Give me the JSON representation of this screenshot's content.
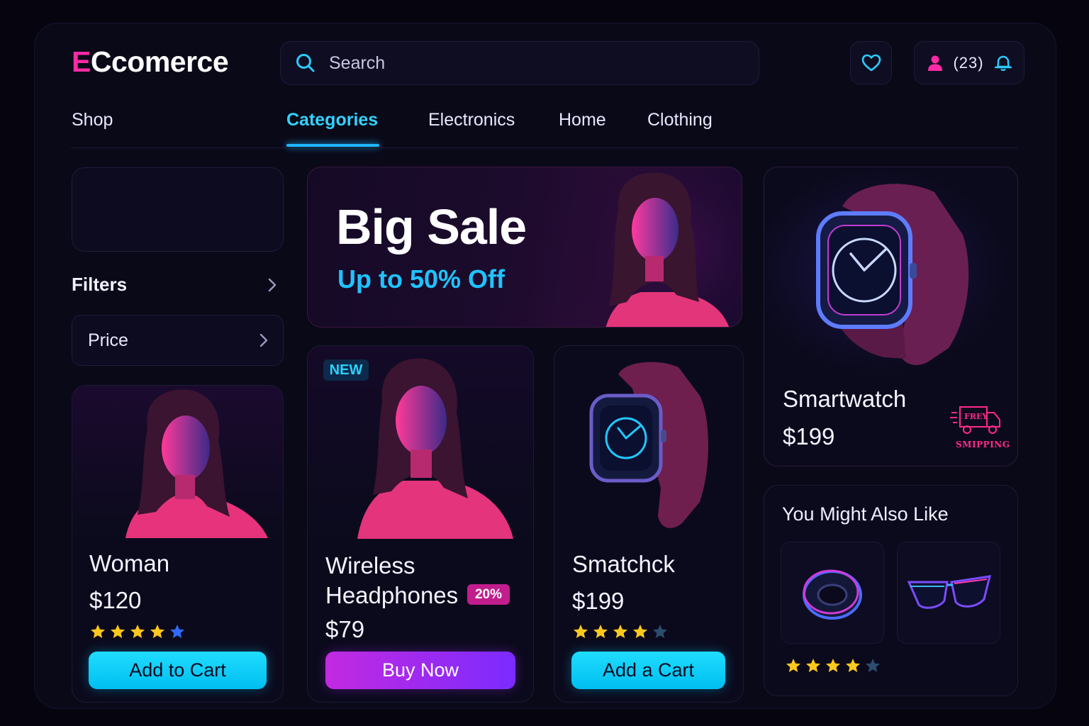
{
  "header": {
    "logo_first": "E",
    "logo_rest": "Ccomerce",
    "search_placeholder": "Search",
    "notification_count": "(23)"
  },
  "nav": {
    "shop": "Shop",
    "tabs": [
      {
        "label": "Categories",
        "active": true
      },
      {
        "label": "Electronics"
      },
      {
        "label": "Home"
      },
      {
        "label": "Clothing"
      }
    ]
  },
  "sidebar": {
    "filters_label": "Filters",
    "price_label": "Price"
  },
  "banner": {
    "title": "Big Sale",
    "subtitle": "Up to 50% Off"
  },
  "products": [
    {
      "title": "Woman",
      "price": "$120",
      "rating": 5,
      "button": "Add to Cart"
    },
    {
      "badge": "NEW",
      "title_line1": "Wireless",
      "title_line2": "Headphones",
      "discount": "20%",
      "price": "$79",
      "button": "Buy Now"
    },
    {
      "title": "Smatchck",
      "price": "$199",
      "rating": 4,
      "button": "Add a Cart"
    }
  ],
  "featured": {
    "title": "Smartwatch",
    "price": "$199",
    "shipping_badge_top": "FREY",
    "shipping_badge_bottom": "SMIPPING"
  },
  "recommendations": {
    "title": "You Might Also Like",
    "items": [
      "ring-icon",
      "glasses-icon"
    ],
    "rating": 4
  },
  "colors": {
    "accent_cyan": "#1fc3ff",
    "accent_pink": "#ff2aa6",
    "accent_purple": "#7b2bff",
    "background": "#06050f"
  }
}
